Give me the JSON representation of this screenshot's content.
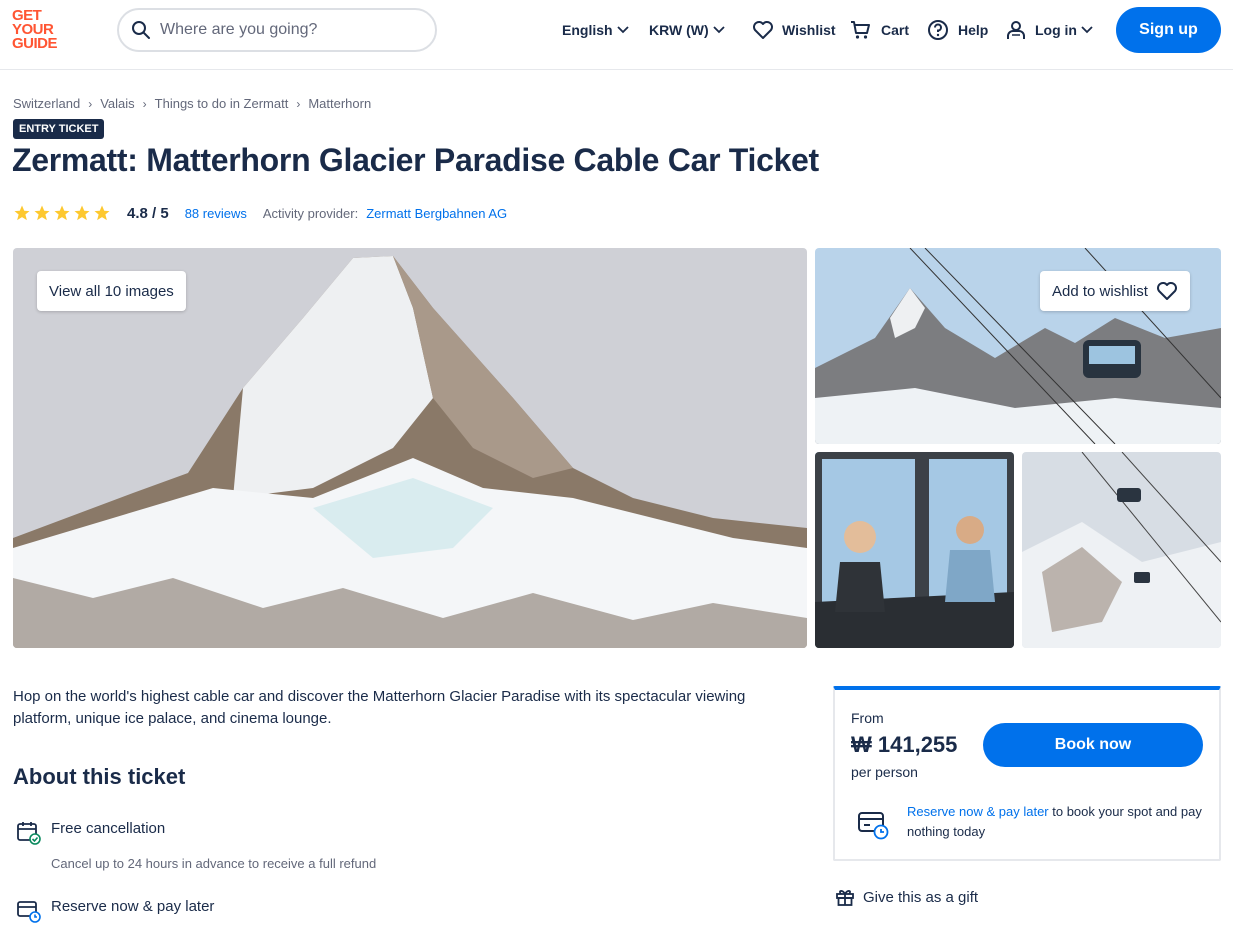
{
  "header": {
    "logo_line1": "GET",
    "logo_line2": "YOUR",
    "logo_line3": "GUIDE",
    "search_placeholder": "Where are you going?",
    "language": "English",
    "currency": "KRW (W)",
    "wishlist": "Wishlist",
    "cart": "Cart",
    "help": "Help",
    "login": "Log in",
    "signup": "Sign up",
    "brand_color": "#ff5533",
    "accent_color": "#0071eb"
  },
  "breadcrumb": [
    "Switzerland",
    "Valais",
    "Things to do in Zermatt",
    "Matterhorn"
  ],
  "badge": "ENTRY TICKET",
  "title": "Zermatt: Matterhorn Glacier Paradise Cable Car Ticket",
  "rating": {
    "stars": 5,
    "score": "4.8 / 5",
    "reviews": "88 reviews",
    "provider_label": "Activity provider:",
    "provider": "Zermatt Bergbahnen AG"
  },
  "gallery": {
    "view_all": "View all 10 images",
    "add_wishlist": "Add to wishlist"
  },
  "summary": "Hop on the world's highest cable car and discover the Matterhorn Glacier Paradise with its spectacular viewing platform, unique ice palace, and cinema lounge.",
  "about": {
    "title": "About this ticket",
    "features": [
      {
        "title": "Free cancellation",
        "desc": "Cancel up to 24 hours in advance to receive a full refund",
        "icon": "calendar-check-icon"
      },
      {
        "title": "Reserve now & pay later",
        "icon": "card-clock-icon"
      }
    ]
  },
  "booking": {
    "from": "From",
    "price": "₩ 141,255",
    "per": "per person",
    "book_now": "Book now",
    "rnpl_link": "Reserve now & pay later",
    "rnpl_text": " to book your spot and pay nothing today",
    "gift": "Give this as a gift"
  }
}
